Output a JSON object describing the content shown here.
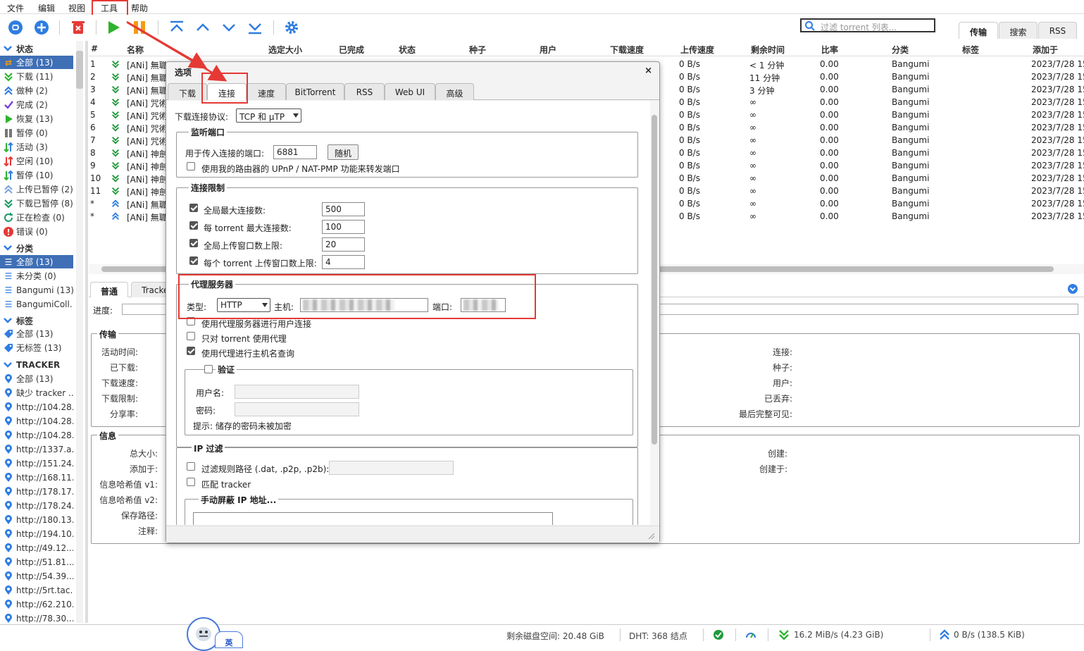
{
  "menubar": {
    "file": "文件",
    "edit": "编辑",
    "view": "视图",
    "tools": "工具",
    "help": "帮助"
  },
  "search": {
    "placeholder": "过滤 torrent 列表..."
  },
  "top_tabs": [
    "传输",
    "搜索",
    "RSS"
  ],
  "sidebar": {
    "status_header": "状态",
    "status_items": [
      "全部 (13)",
      "下载 (11)",
      "做种 (2)",
      "完成 (2)",
      "恢复 (13)",
      "暂停 (0)",
      "活动 (3)",
      "空闲 (10)",
      "暂停 (10)",
      "上传已暂停 (2)",
      "下载已暂停 (8)",
      "正在检查 (0)",
      "错误 (0)"
    ],
    "category_header": "分类",
    "category_items": [
      "全部 (13)",
      "未分类 (0)",
      "Bangumi (13)",
      "BangumiColl..."
    ],
    "tag_header": "标签",
    "tag_items": [
      "全部 (13)",
      "无标签 (13)"
    ],
    "tracker_header": "TRACKER",
    "tracker_items": [
      "全部 (13)",
      "缺少 tracker ...",
      "http://104.28....",
      "http://104.28....",
      "http://104.28....",
      "http://1337.a...",
      "http://151.24....",
      "http://168.11....",
      "http://178.17....",
      "http://178.24....",
      "http://180.13....",
      "http://194.10....",
      "http://49.12....",
      "http://51.81....",
      "http://54.39....",
      "http://5rt.tac...",
      "http://62.210....",
      "http://78.30...."
    ]
  },
  "table": {
    "headers": [
      "#",
      "名称",
      "选定大小",
      "已完成",
      "状态",
      "种子",
      "用户",
      "下载速度",
      "上传速度",
      "剩余时间",
      "比率",
      "分类",
      "标签",
      "添加于"
    ],
    "rows": [
      {
        "num": "1",
        "name": "[ANi] 無職",
        "up": "0 B/s",
        "eta": "< 1 分钟",
        "ratio": "0.00",
        "cat": "Bangumi",
        "added": "2023/7/28 15:"
      },
      {
        "num": "2",
        "name": "[ANi] 無職",
        "up": "0 B/s",
        "eta": "11 分钟",
        "ratio": "0.00",
        "cat": "Bangumi",
        "added": "2023/7/28 15:"
      },
      {
        "num": "3",
        "name": "[ANi] 無職",
        "up": "0 B/s",
        "eta": "3 分钟",
        "ratio": "0.00",
        "cat": "Bangumi",
        "added": "2023/7/28 15:"
      },
      {
        "num": "4",
        "name": "[ANi] 咒術",
        "up": "0 B/s",
        "eta": "∞",
        "ratio": "0.00",
        "cat": "Bangumi",
        "added": "2023/7/28 15:"
      },
      {
        "num": "5",
        "name": "[ANi] 咒術",
        "up": "0 B/s",
        "eta": "∞",
        "ratio": "0.00",
        "cat": "Bangumi",
        "added": "2023/7/28 15:"
      },
      {
        "num": "6",
        "name": "[ANi] 咒術",
        "up": "0 B/s",
        "eta": "∞",
        "ratio": "0.00",
        "cat": "Bangumi",
        "added": "2023/7/28 15:"
      },
      {
        "num": "7",
        "name": "[ANi] 咒術",
        "up": "0 B/s",
        "eta": "∞",
        "ratio": "0.00",
        "cat": "Bangumi",
        "added": "2023/7/28 15:"
      },
      {
        "num": "8",
        "name": "[ANi] 神劍",
        "up": "0 B/s",
        "eta": "∞",
        "ratio": "0.00",
        "cat": "Bangumi",
        "added": "2023/7/28 15:"
      },
      {
        "num": "9",
        "name": "[ANi] 神劍",
        "up": "0 B/s",
        "eta": "∞",
        "ratio": "0.00",
        "cat": "Bangumi",
        "added": "2023/7/28 15:"
      },
      {
        "num": "10",
        "name": "[ANi] 神劍",
        "up": "0 B/s",
        "eta": "∞",
        "ratio": "0.00",
        "cat": "Bangumi",
        "added": "2023/7/28 15:"
      },
      {
        "num": "11",
        "name": "[ANi] 神劍",
        "up": "0 B/s",
        "eta": "∞",
        "ratio": "0.00",
        "cat": "Bangumi",
        "added": "2023/7/28 15:"
      },
      {
        "num": "*",
        "name": "[ANi] 無職",
        "up": "0 B/s",
        "eta": "∞",
        "ratio": "0.00",
        "cat": "Bangumi",
        "added": "2023/7/28 15:"
      },
      {
        "num": "*",
        "name": "[ANi] 無職",
        "up": "0 B/s",
        "eta": "∞",
        "ratio": "0.00",
        "cat": "Bangumi",
        "added": "2023/7/28 15:"
      }
    ]
  },
  "details": {
    "tabs": [
      "普通",
      "Tracke"
    ],
    "progress_label": "进度:",
    "transfer_title": "传输",
    "transfer_labels": [
      "活动时间:",
      "已下载:",
      "下载速度:",
      "下载限制:",
      "分享率:"
    ],
    "transfer_right_labels": [
      "连接:",
      "种子:",
      "用户:",
      "已丢弃:",
      "最后完整可见:"
    ],
    "info_title": "信息",
    "info_labels": [
      "总大小:",
      "添加于:",
      "信息哈希值 v1:",
      "信息哈希值 v2:",
      "保存路径:",
      "注释:"
    ],
    "info_right_labels": [
      "创建:",
      "创建于:"
    ]
  },
  "dialog": {
    "title": "选项",
    "close": "×",
    "tabs": [
      "下载",
      "连接",
      "速度",
      "BitTorrent",
      "RSS",
      "Web UI",
      "高级"
    ],
    "protocol_label": "下载连接协议:",
    "protocol_value": "TCP 和 μTP",
    "listen_title": "监听端口",
    "port_label": "用于传入连接的端口:",
    "port_value": "6881",
    "random_button": "随机",
    "upnp_label": "使用我的路由器的 UPnP / NAT-PMP 功能来转发端口",
    "limits_title": "连接限制",
    "limits": [
      {
        "label": "全局最大连接数:",
        "value": "500"
      },
      {
        "label": "每 torrent 最大连接数:",
        "value": "100"
      },
      {
        "label": "全局上传窗口数上限:",
        "value": "20"
      },
      {
        "label": "每个 torrent 上传窗口数上限:",
        "value": "4"
      }
    ],
    "proxy_title": "代理服务器",
    "proxy_type_label": "类型:",
    "proxy_type_value": "HTTP",
    "proxy_host_label": "主机:",
    "proxy_port_label": "端口:",
    "proxy_peer_label": "使用代理服务器进行用户连接",
    "proxy_torrent_only_label": "只对 torrent 使用代理",
    "proxy_hostname_label": "使用代理进行主机名查询",
    "auth_title": "验证",
    "username_label": "用户名:",
    "password_label": "密码:",
    "auth_hint": "提示: 储存的密码未被加密",
    "ipfilter_title": "IP 过滤",
    "filter_path_label": "过滤规则路径 (.dat, .p2p, .p2b):",
    "match_tracker_label": "匹配 tracker",
    "manual_ban_title": "手动屏蔽 IP 地址..."
  },
  "statusbar": {
    "disk": "剩余磁盘空间: 20.48 GiB",
    "dht": "DHT: 368 结点",
    "download": "16.2 MiB/s (4.23 GiB)",
    "upload": "0 B/s (138.5 KiB)"
  },
  "assistant_badge": "英"
}
